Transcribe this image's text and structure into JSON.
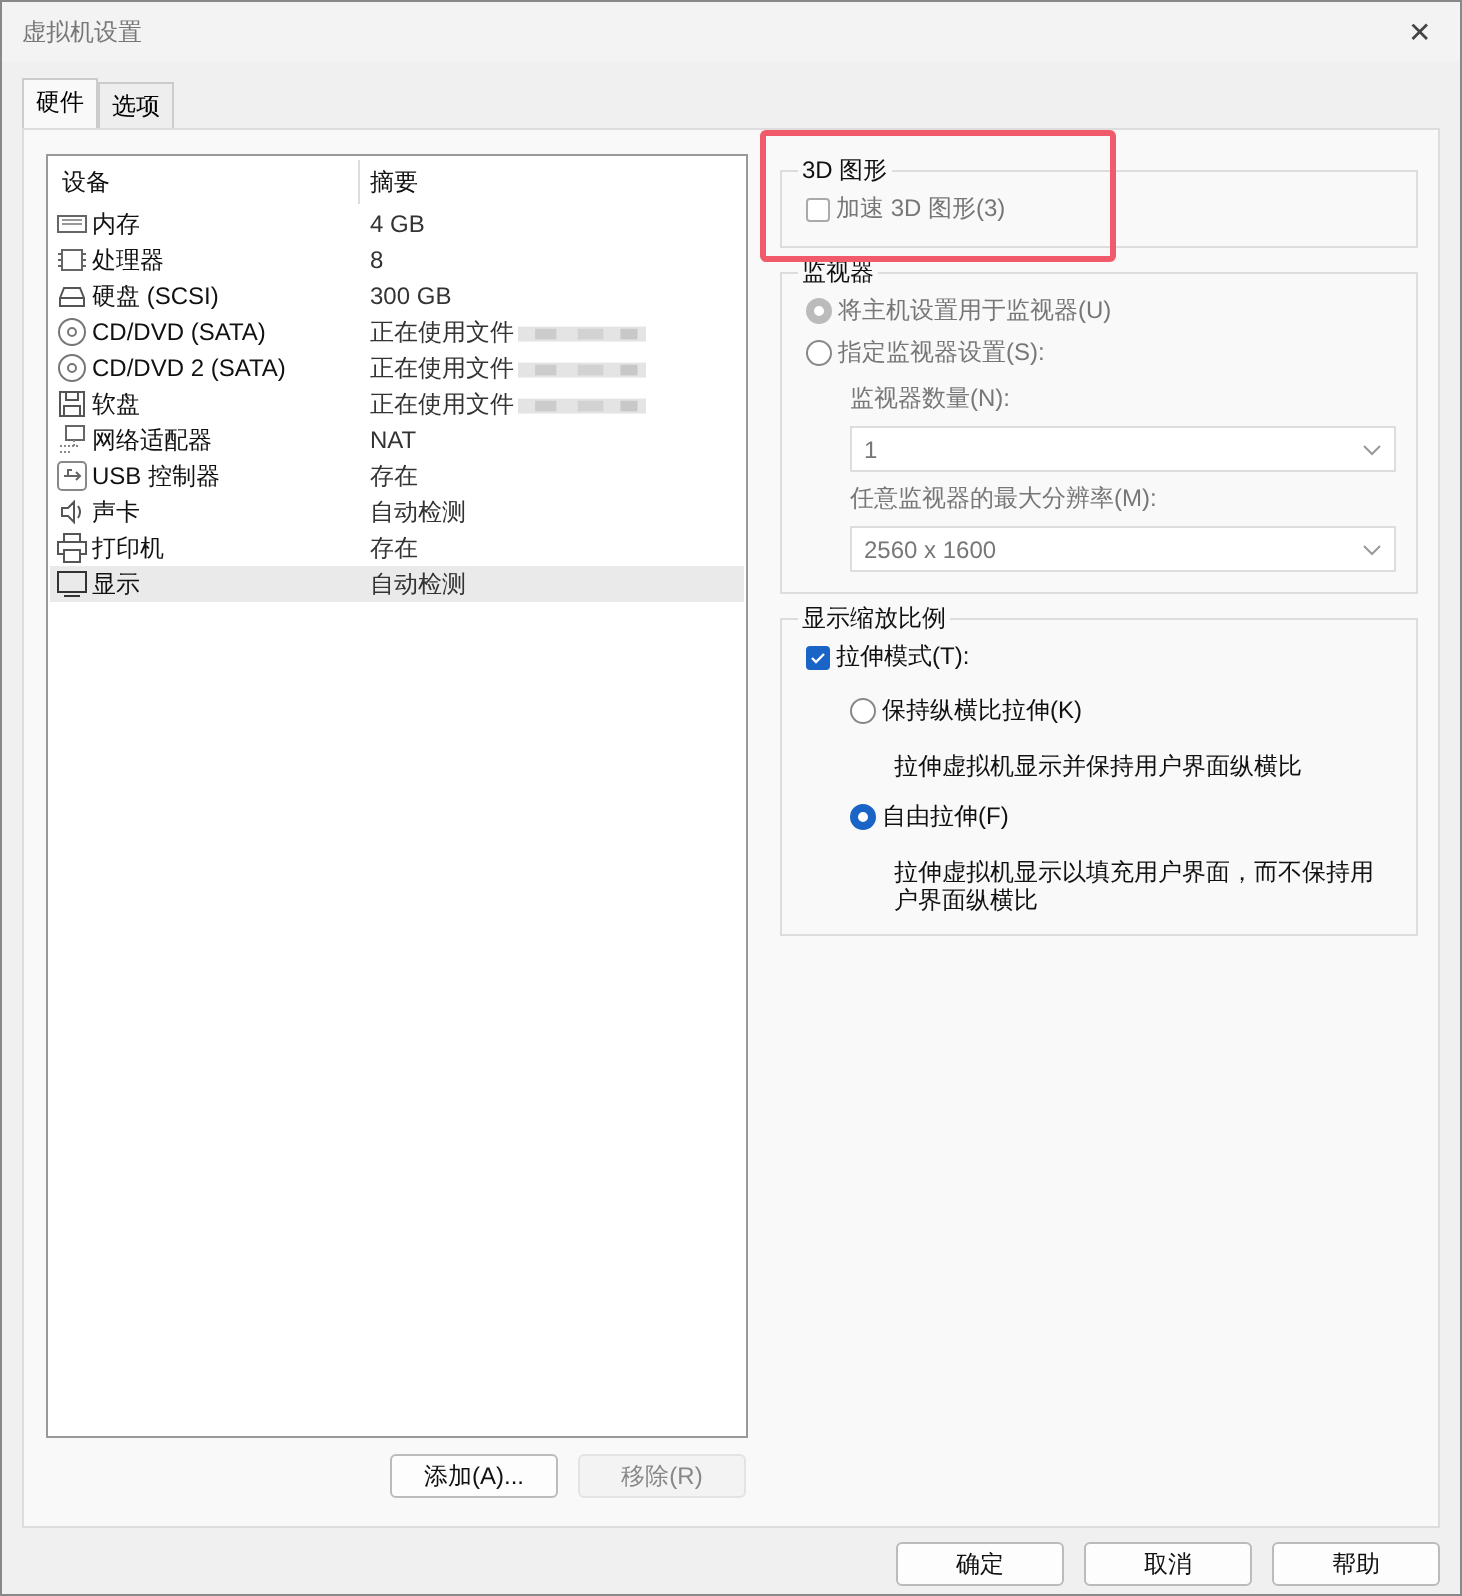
{
  "window": {
    "title": "虚拟机设置",
    "close": "✕"
  },
  "tabs": [
    {
      "label": "硬件",
      "selected": true
    },
    {
      "label": "选项",
      "selected": false
    }
  ],
  "device_table": {
    "columns": [
      "设备",
      "摘要"
    ],
    "rows": [
      {
        "device": "内存",
        "summary": "4 GB",
        "selected": false,
        "blurred": false
      },
      {
        "device": "处理器",
        "summary": "8",
        "selected": false,
        "blurred": false
      },
      {
        "device": "硬盘 (SCSI)",
        "summary": "300 GB",
        "selected": false,
        "blurred": false
      },
      {
        "device": "CD/DVD (SATA)",
        "summary": "正在使用文件",
        "selected": false,
        "blurred": true
      },
      {
        "device": "CD/DVD 2 (SATA)",
        "summary": "正在使用文件",
        "selected": false,
        "blurred": true
      },
      {
        "device": "软盘",
        "summary": "正在使用文件",
        "selected": false,
        "blurred": true
      },
      {
        "device": "网络适配器",
        "summary": "NAT",
        "selected": false,
        "blurred": false
      },
      {
        "device": "USB 控制器",
        "summary": "存在",
        "selected": false,
        "blurred": false
      },
      {
        "device": "声卡",
        "summary": "自动检测",
        "selected": false,
        "blurred": false
      },
      {
        "device": "打印机",
        "summary": "存在",
        "selected": false,
        "blurred": false
      },
      {
        "device": "显示",
        "summary": "自动检测",
        "selected": true,
        "blurred": false
      }
    ]
  },
  "list_buttons": [
    {
      "label": "添加(A)...",
      "disabled": false
    },
    {
      "label": "移除(R)",
      "disabled": true
    }
  ],
  "graphics_3d": {
    "title": "3D 图形",
    "checkbox": {
      "label": "加速 3D 图形(3)",
      "checked": false,
      "disabled": true
    },
    "highlighted": true
  },
  "monitors": {
    "title": "监视器",
    "disabled": true,
    "options": [
      {
        "label": "将主机设置用于监视器(U)",
        "selected": true
      },
      {
        "label": "指定监视器设置(S):",
        "selected": false
      }
    ],
    "count_label": "监视器数量(N):",
    "count_value": "1",
    "resolution_label": "任意监视器的最大分辨率(M):",
    "resolution_value": "2560 x 1600"
  },
  "scaling": {
    "title": "显示缩放比例",
    "stretch": {
      "label": "拉伸模式(T):",
      "checked": true
    },
    "options": [
      {
        "label": "保持纵横比拉伸(K)",
        "description": "拉伸虚拟机显示并保持用户界面纵横比",
        "selected": false
      },
      {
        "label": "自由拉伸(F)",
        "description": "拉伸虚拟机显示以填充用户界面，而不保持用户界面纵横比",
        "selected": true
      }
    ]
  },
  "dialog_buttons": [
    "确定",
    "取消",
    "帮助"
  ]
}
